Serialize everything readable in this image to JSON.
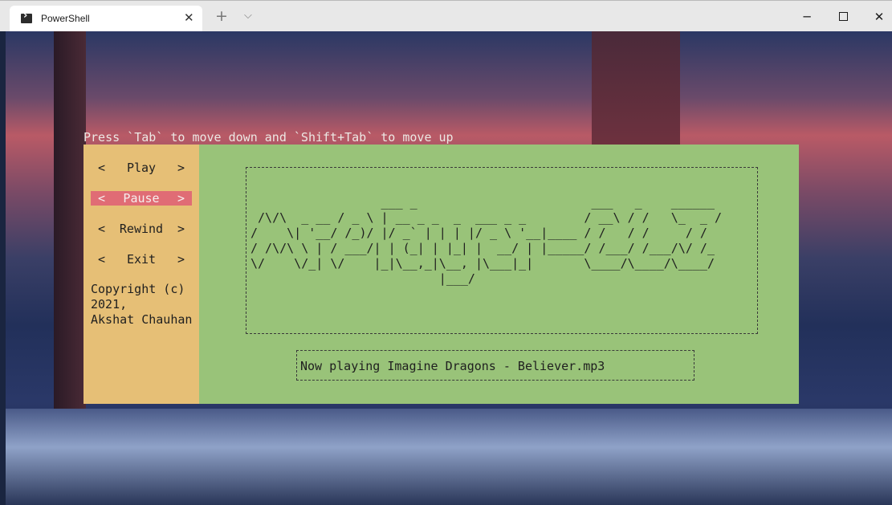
{
  "window": {
    "tab_title": "PowerShell",
    "tab_icon": "powershell-icon",
    "new_tab_symbol": "+",
    "dropdown_symbol": "⌵",
    "close_tab_symbol": "✕",
    "minimize_symbol": "─",
    "close_symbol": "✕"
  },
  "terminal": {
    "hint": "Press `Tab` to move down and `Shift+Tab` to move up"
  },
  "sidebar": {
    "items": [
      {
        "label": "Play"
      },
      {
        "label": "Pause"
      },
      {
        "label": "Rewind"
      },
      {
        "label": "Exit"
      }
    ],
    "arrow_left": "<",
    "arrow_right": ">",
    "copyright": "Copyright (c)\n2021,\nAkshat Chauhan"
  },
  "main": {
    "ascii_banner": "                  ___ _                        ___   _    ______\n /\\/\\  _ __ / _ \\ | __ _ _  _  ___ _ _        / __\\ / /   \\_  _ /\n/    \\| '__/ /_)/ |/ _` | | | |/ _ \\ '__|____ / /   / /     / /\n/ /\\/\\ \\ | / ___/| | (_| | |_| |  __/ | |_____/ /___/ /___/\\/ /_\n\\/    \\/_| \\/    |_|\\__,_|\\__, |\\___|_|       \\____/\\____/\\____/\n                          |___/",
    "now_playing": "Now playing Imagine Dragons - Believer.mp3"
  },
  "colors": {
    "sidebar_bg": "#e6bf76",
    "main_bg": "#99c379",
    "active_button_bg": "#e06c75"
  }
}
